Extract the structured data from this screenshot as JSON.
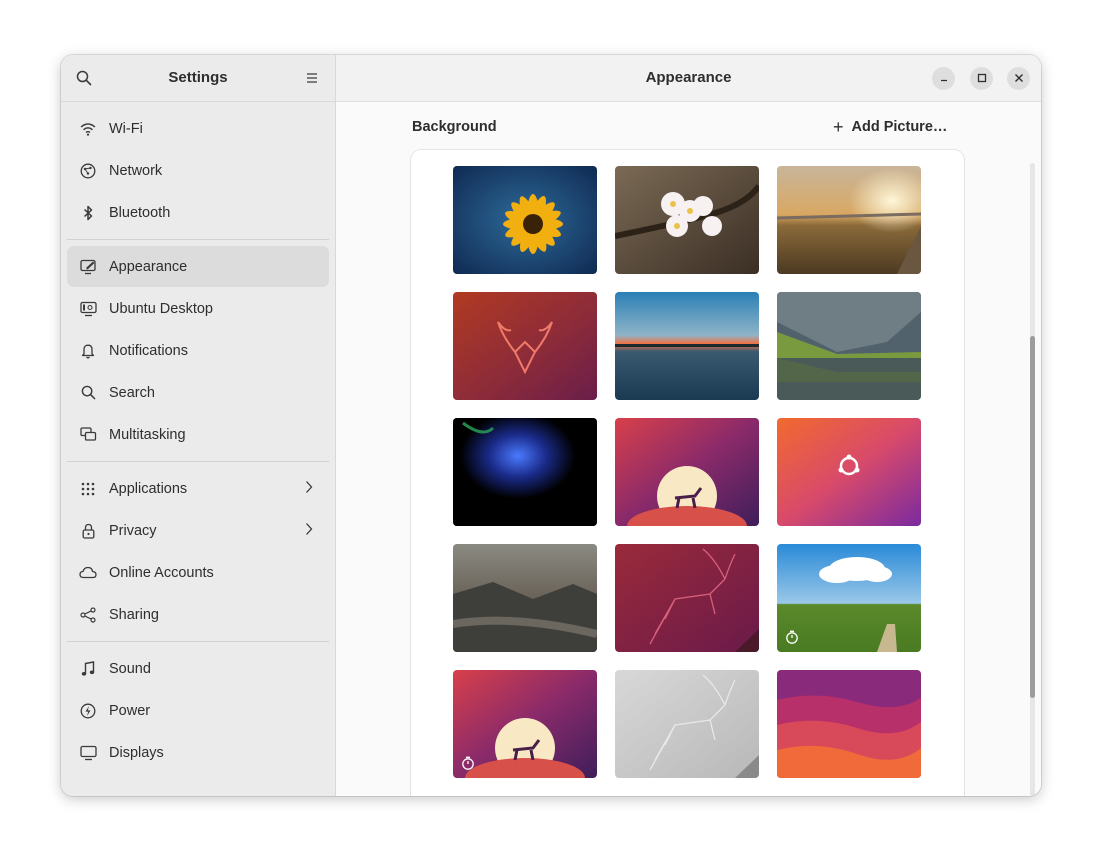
{
  "sidebar": {
    "title": "Settings",
    "search_icon": "search-icon",
    "menu_icon": "hamburger-menu-icon",
    "groups": [
      [
        {
          "label": "Wi-Fi",
          "icon": "wifi-icon"
        },
        {
          "label": "Network",
          "icon": "network-icon"
        },
        {
          "label": "Bluetooth",
          "icon": "bluetooth-icon"
        }
      ],
      [
        {
          "label": "Appearance",
          "icon": "appearance-icon",
          "active": true
        },
        {
          "label": "Ubuntu Desktop",
          "icon": "ubuntu-desktop-icon"
        },
        {
          "label": "Notifications",
          "icon": "bell-icon"
        },
        {
          "label": "Search",
          "icon": "search-icon"
        },
        {
          "label": "Multitasking",
          "icon": "multitasking-icon"
        }
      ],
      [
        {
          "label": "Applications",
          "icon": "apps-grid-icon",
          "chevron": true
        },
        {
          "label": "Privacy",
          "icon": "lock-icon",
          "chevron": true
        },
        {
          "label": "Online Accounts",
          "icon": "cloud-icon"
        },
        {
          "label": "Sharing",
          "icon": "share-icon"
        }
      ],
      [
        {
          "label": "Sound",
          "icon": "music-note-icon"
        },
        {
          "label": "Power",
          "icon": "power-icon"
        },
        {
          "label": "Displays",
          "icon": "monitor-icon"
        }
      ]
    ]
  },
  "content": {
    "title": "Appearance",
    "section_title": "Background",
    "add_picture_label": "Add Picture…"
  },
  "wallpapers": [
    {
      "name": "yellow-flower",
      "timed": false
    },
    {
      "name": "cherry-blossom",
      "timed": false
    },
    {
      "name": "sunset-boardwalk",
      "timed": false
    },
    {
      "name": "kudu-head-red",
      "timed": false
    },
    {
      "name": "lake-sunset",
      "timed": false
    },
    {
      "name": "mountain-lake-reflection",
      "timed": false
    },
    {
      "name": "blue-smoke",
      "timed": false
    },
    {
      "name": "moon-antelope",
      "timed": false
    },
    {
      "name": "ubuntu-logo-gradient",
      "timed": false
    },
    {
      "name": "misty-mountains",
      "timed": false
    },
    {
      "name": "leaping-antelope-red",
      "timed": false
    },
    {
      "name": "green-hills-sky",
      "timed": true
    },
    {
      "name": "moon-antelope-timed",
      "timed": true
    },
    {
      "name": "leaping-antelope-light",
      "timed": false
    },
    {
      "name": "wavy-gradient",
      "timed": false
    }
  ],
  "colors": {
    "sidebar_bg": "#ebebeb",
    "active_item_bg": "#dcdcdc",
    "content_bg": "#fafafa"
  }
}
